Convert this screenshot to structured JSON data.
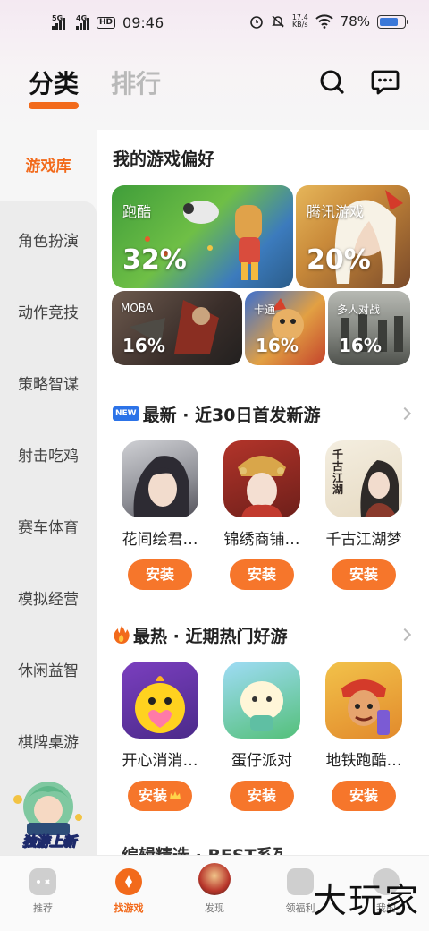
{
  "status_bar": {
    "net1": "5G",
    "net2": "4G",
    "hd": "HD",
    "time": "09:46",
    "speed_value": "17.4",
    "speed_unit": "KB/s",
    "battery_pct": "78%",
    "battery_level": 0.78
  },
  "header": {
    "tab_active": "分类",
    "tab_inactive": "排行",
    "icons": [
      "search-icon",
      "message-icon"
    ]
  },
  "sidebar": {
    "active": "游戏库",
    "items": [
      "角色扮演",
      "动作竞技",
      "策略智谋",
      "射击吃鸡",
      "赛车体育",
      "模拟经营",
      "休闲益智",
      "棋牌桌游"
    ],
    "promo_label": "独游上新"
  },
  "preferences": {
    "title": "我的游戏偏好",
    "tiles": [
      {
        "name": "跑酷",
        "pct": "32%"
      },
      {
        "name": "腾讯游戏",
        "pct": "20%"
      },
      {
        "name": "MOBA",
        "pct": "16%"
      },
      {
        "name": "卡通",
        "pct": "16%"
      },
      {
        "name": "多人对战",
        "pct": "16%"
      }
    ]
  },
  "new_section": {
    "badge": "NEW",
    "title": "最新 · 近30日首发新游",
    "games": [
      {
        "name": "花间绘君…",
        "button": "安装"
      },
      {
        "name": "锦绣商铺…",
        "button": "安装"
      },
      {
        "name": "千古江湖梦",
        "button": "安装"
      }
    ],
    "icon3_text": "千古江湖"
  },
  "hot_section": {
    "title": "最热 · 近期热门好游",
    "games": [
      {
        "name": "开心消消…",
        "button": "安装"
      },
      {
        "name": "蛋仔派对",
        "button": "安装"
      },
      {
        "name": "地铁跑酷…",
        "button": "安装"
      }
    ]
  },
  "next_section": {
    "title": "编辑精选 · BEST系列"
  },
  "bottom_nav": {
    "items": [
      "推荐",
      "找游戏",
      "发现",
      "领福利",
      "我的"
    ],
    "active_color": "#f26a1b"
  },
  "watermark": "大玩家",
  "colors": {
    "accent": "#f26a1b",
    "button": "#f6762b"
  }
}
